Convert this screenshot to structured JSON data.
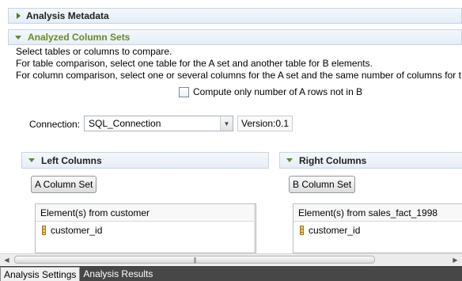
{
  "sections": {
    "metadata": {
      "title": "Analysis Metadata"
    },
    "column_sets": {
      "title": "Analyzed Column Sets"
    }
  },
  "description": {
    "line1": "Select tables or columns to compare.",
    "line2": "For table comparison, select one table for the A set and another table for B elements.",
    "line3": "For column comparison, select one or several columns for the A set and the same number of columns for t"
  },
  "options": {
    "compute_only_label": "Compute only number of A rows not in B",
    "compute_only_checked": false
  },
  "connection": {
    "label": "Connection:",
    "value": "SQL_Connection",
    "version": "Version:0.1"
  },
  "left": {
    "title": "Left Columns",
    "button": "A Column Set",
    "list_header": "Element(s) from customer",
    "items": [
      "customer_id"
    ]
  },
  "right": {
    "title": "Right Columns",
    "button": "B Column Set",
    "list_header": "Element(s) from sales_fact_1998",
    "items": [
      "customer_id"
    ]
  },
  "scrollbar": {
    "left_arrow": "◀",
    "right_arrow": "▶",
    "grip": "|||"
  },
  "tabs": [
    "Analysis Settings",
    "Analysis Results"
  ],
  "active_tab": "Analysis Settings",
  "colors": {
    "section_green": "#6a8a26",
    "tab_bar": "#474747"
  }
}
